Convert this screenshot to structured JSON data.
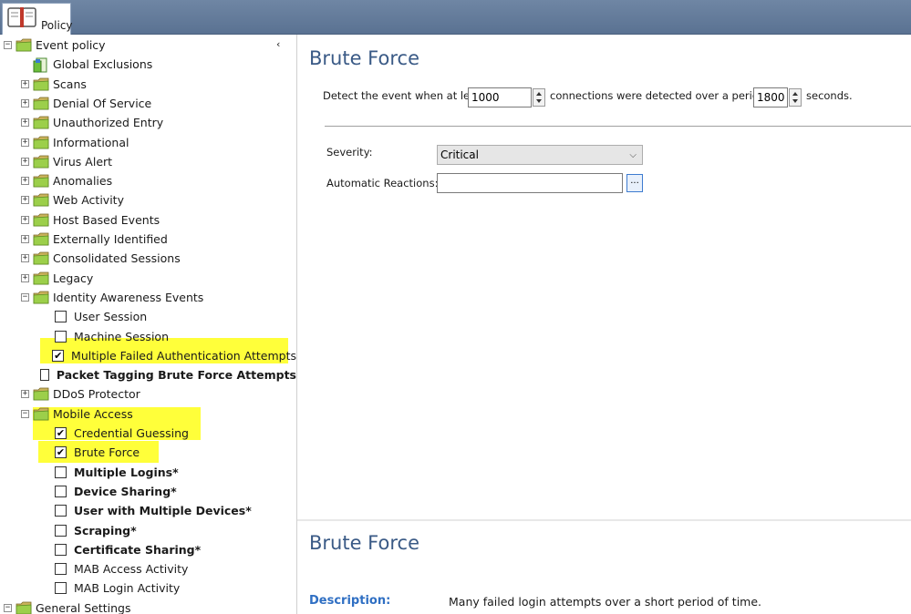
{
  "window": {
    "tab_label": "Policy",
    "accent_color": "#3a5a86"
  },
  "tree": {
    "root": {
      "label": "Event policy",
      "expander": "⊟"
    },
    "collapse_glyph": "‹",
    "items": [
      {
        "label": "Global Exclusions",
        "kind": "leaf-doc"
      },
      {
        "label": "Scans",
        "kind": "folder",
        "expander": "+"
      },
      {
        "label": "Denial Of Service",
        "kind": "folder",
        "expander": "+"
      },
      {
        "label": "Unauthorized Entry",
        "kind": "folder",
        "expander": "+"
      },
      {
        "label": "Informational",
        "kind": "folder",
        "expander": "+"
      },
      {
        "label": "Virus Alert",
        "kind": "folder",
        "expander": "+"
      },
      {
        "label": "Anomalies",
        "kind": "folder",
        "expander": "+"
      },
      {
        "label": "Web Activity",
        "kind": "folder",
        "expander": "+"
      },
      {
        "label": "Host Based Events",
        "kind": "folder",
        "expander": "+"
      },
      {
        "label": "Externally Identified",
        "kind": "folder",
        "expander": "+"
      },
      {
        "label": "Consolidated Sessions",
        "kind": "folder",
        "expander": "+"
      },
      {
        "label": "Legacy",
        "kind": "folder",
        "expander": "+"
      },
      {
        "label": "Identity Awareness Events",
        "kind": "folder",
        "expander": "−"
      },
      {
        "label": "User Session",
        "kind": "check",
        "checked": false,
        "bold": false
      },
      {
        "label": "Machine Session",
        "kind": "check",
        "checked": false,
        "bold": false
      },
      {
        "label": "Multiple Failed Authentication Attempts",
        "kind": "check",
        "checked": true,
        "bold": false
      },
      {
        "label": "Packet Tagging Brute Force Attempts",
        "kind": "check",
        "checked": false,
        "bold": true
      },
      {
        "label": "DDoS Protector",
        "kind": "folder",
        "expander": "+"
      },
      {
        "label": "Mobile Access",
        "kind": "folder",
        "expander": "−"
      },
      {
        "label": "Credential Guessing",
        "kind": "check",
        "checked": true,
        "bold": false
      },
      {
        "label": "Brute Force",
        "kind": "check",
        "checked": true,
        "bold": false
      },
      {
        "label": "Multiple Logins*",
        "kind": "check",
        "checked": false,
        "bold": true
      },
      {
        "label": "Device Sharing*",
        "kind": "check",
        "checked": false,
        "bold": true
      },
      {
        "label": "User with Multiple Devices*",
        "kind": "check",
        "checked": false,
        "bold": true
      },
      {
        "label": "Scraping*",
        "kind": "check",
        "checked": false,
        "bold": true
      },
      {
        "label": "Certificate Sharing*",
        "kind": "check",
        "checked": false,
        "bold": true
      },
      {
        "label": "MAB Access Activity",
        "kind": "check",
        "checked": false,
        "bold": false
      },
      {
        "label": "MAB Login Activity",
        "kind": "check",
        "checked": false,
        "bold": false
      }
    ],
    "footer": {
      "label": "General Settings",
      "expander": "⊟"
    },
    "highlight_color": "#ffff3a"
  },
  "detail": {
    "title": "Brute Force",
    "detect_prefix": "Detect the event when at least",
    "connections_value": "1000",
    "detect_middle": "connections were detected over a period of",
    "period_value": "1800",
    "detect_suffix": "seconds.",
    "severity_label": "Severity:",
    "severity_value": "Critical",
    "reactions_label": "Automatic Reactions:",
    "reactions_value": "",
    "browse_label": "..."
  },
  "description_panel": {
    "title": "Brute Force",
    "key": "Description:",
    "value": "Many failed login attempts over a short period of time."
  }
}
